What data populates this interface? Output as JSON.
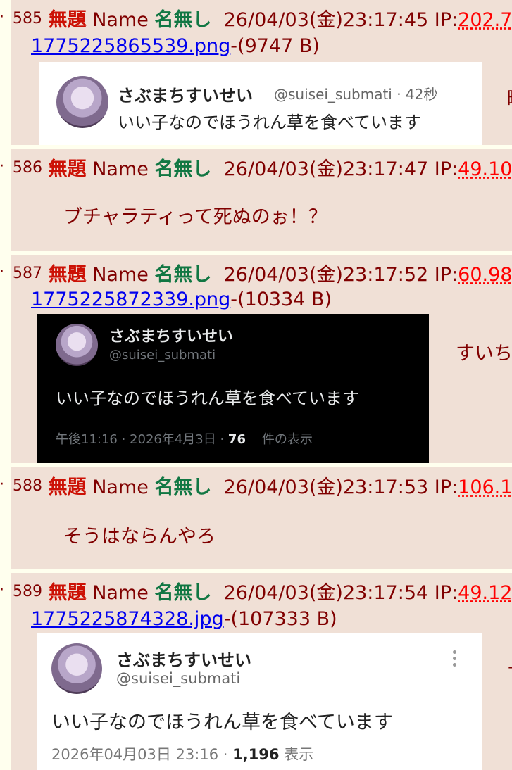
{
  "posts": [
    {
      "number": "585",
      "subject": "無題",
      "name_label": "Name",
      "name": "名無し",
      "datetime": "26/04/03(金)23:17:45",
      "ip_label": "IP:",
      "ip": "202.7",
      "file": {
        "name": "1775225865539.png",
        "size": "-(9747 B)"
      },
      "aside": "町",
      "thumb": {
        "theme": "light-inline",
        "display_name": "さぶまちすいせい",
        "handle_time": "@suisei_submati · 42秒",
        "text": "いい子なのでほうれん草を食べています"
      }
    },
    {
      "number": "586",
      "subject": "無題",
      "name_label": "Name",
      "name": "名無し",
      "datetime": "26/04/03(金)23:17:47",
      "ip_label": "IP:",
      "ip": "49.10",
      "message": "ブチャラティって死ぬのぉ！？"
    },
    {
      "number": "587",
      "subject": "無題",
      "name_label": "Name",
      "name": "名無し",
      "datetime": "26/04/03(金)23:17:52",
      "ip_label": "IP:",
      "ip": "60.98",
      "file": {
        "name": "1775225872339.png",
        "size": "-(10334 B)"
      },
      "aside": "すいち",
      "thumb": {
        "theme": "dark",
        "display_name": "さぶまちすいせい",
        "handle": "@suisei_submati",
        "text": "いい子なのでほうれん草を食べています",
        "meta_prefix": "午後11:16 · 2026年4月3日 · ",
        "views": "76",
        "meta_suffix": "件の表示"
      }
    },
    {
      "number": "588",
      "subject": "無題",
      "name_label": "Name",
      "name": "名無し",
      "datetime": "26/04/03(金)23:17:53",
      "ip_label": "IP:",
      "ip": "106.1",
      "message": "そうはならんやろ"
    },
    {
      "number": "589",
      "subject": "無題",
      "name_label": "Name",
      "name": "名無し",
      "datetime": "26/04/03(金)23:17:54",
      "ip_label": "IP:",
      "ip": "49.12",
      "file": {
        "name": "1775225874328.jpg",
        "size": "-(107333 B)"
      },
      "aside": "-",
      "thumb": {
        "theme": "light",
        "display_name": "さぶまちすいせい",
        "handle": "@suisei_submati",
        "text": "いい子なのでほうれん草を食べています",
        "meta_prefix": "2026年04月03日 23:16 · ",
        "views": "1,196",
        "meta_suffix": " 表示",
        "menu_icon": "vertical-dots-icon"
      }
    }
  ],
  "colors": {
    "subject": "#cc1105",
    "name": "#117743",
    "post_bg": "#f0e0d6",
    "page_bg": "#ffffee",
    "text": "#800000",
    "ip": "#ff0000"
  }
}
